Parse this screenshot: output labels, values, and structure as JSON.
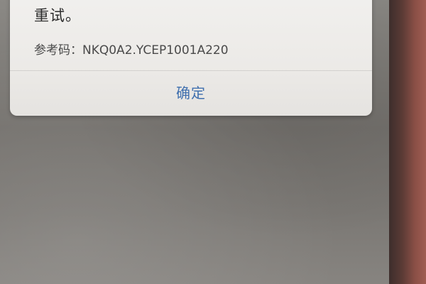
{
  "dialog": {
    "message": "重试。",
    "reference_label": "参考码：",
    "reference_code": "NKQ0A2.YCEP1001A220",
    "confirm_label": "确定"
  },
  "colors": {
    "dialog_background": "#eceae7",
    "button_text": "#3f6fae",
    "message_text": "#2d2d2d",
    "screen_background": "#7b7874",
    "bezel": "#8a4f46"
  }
}
